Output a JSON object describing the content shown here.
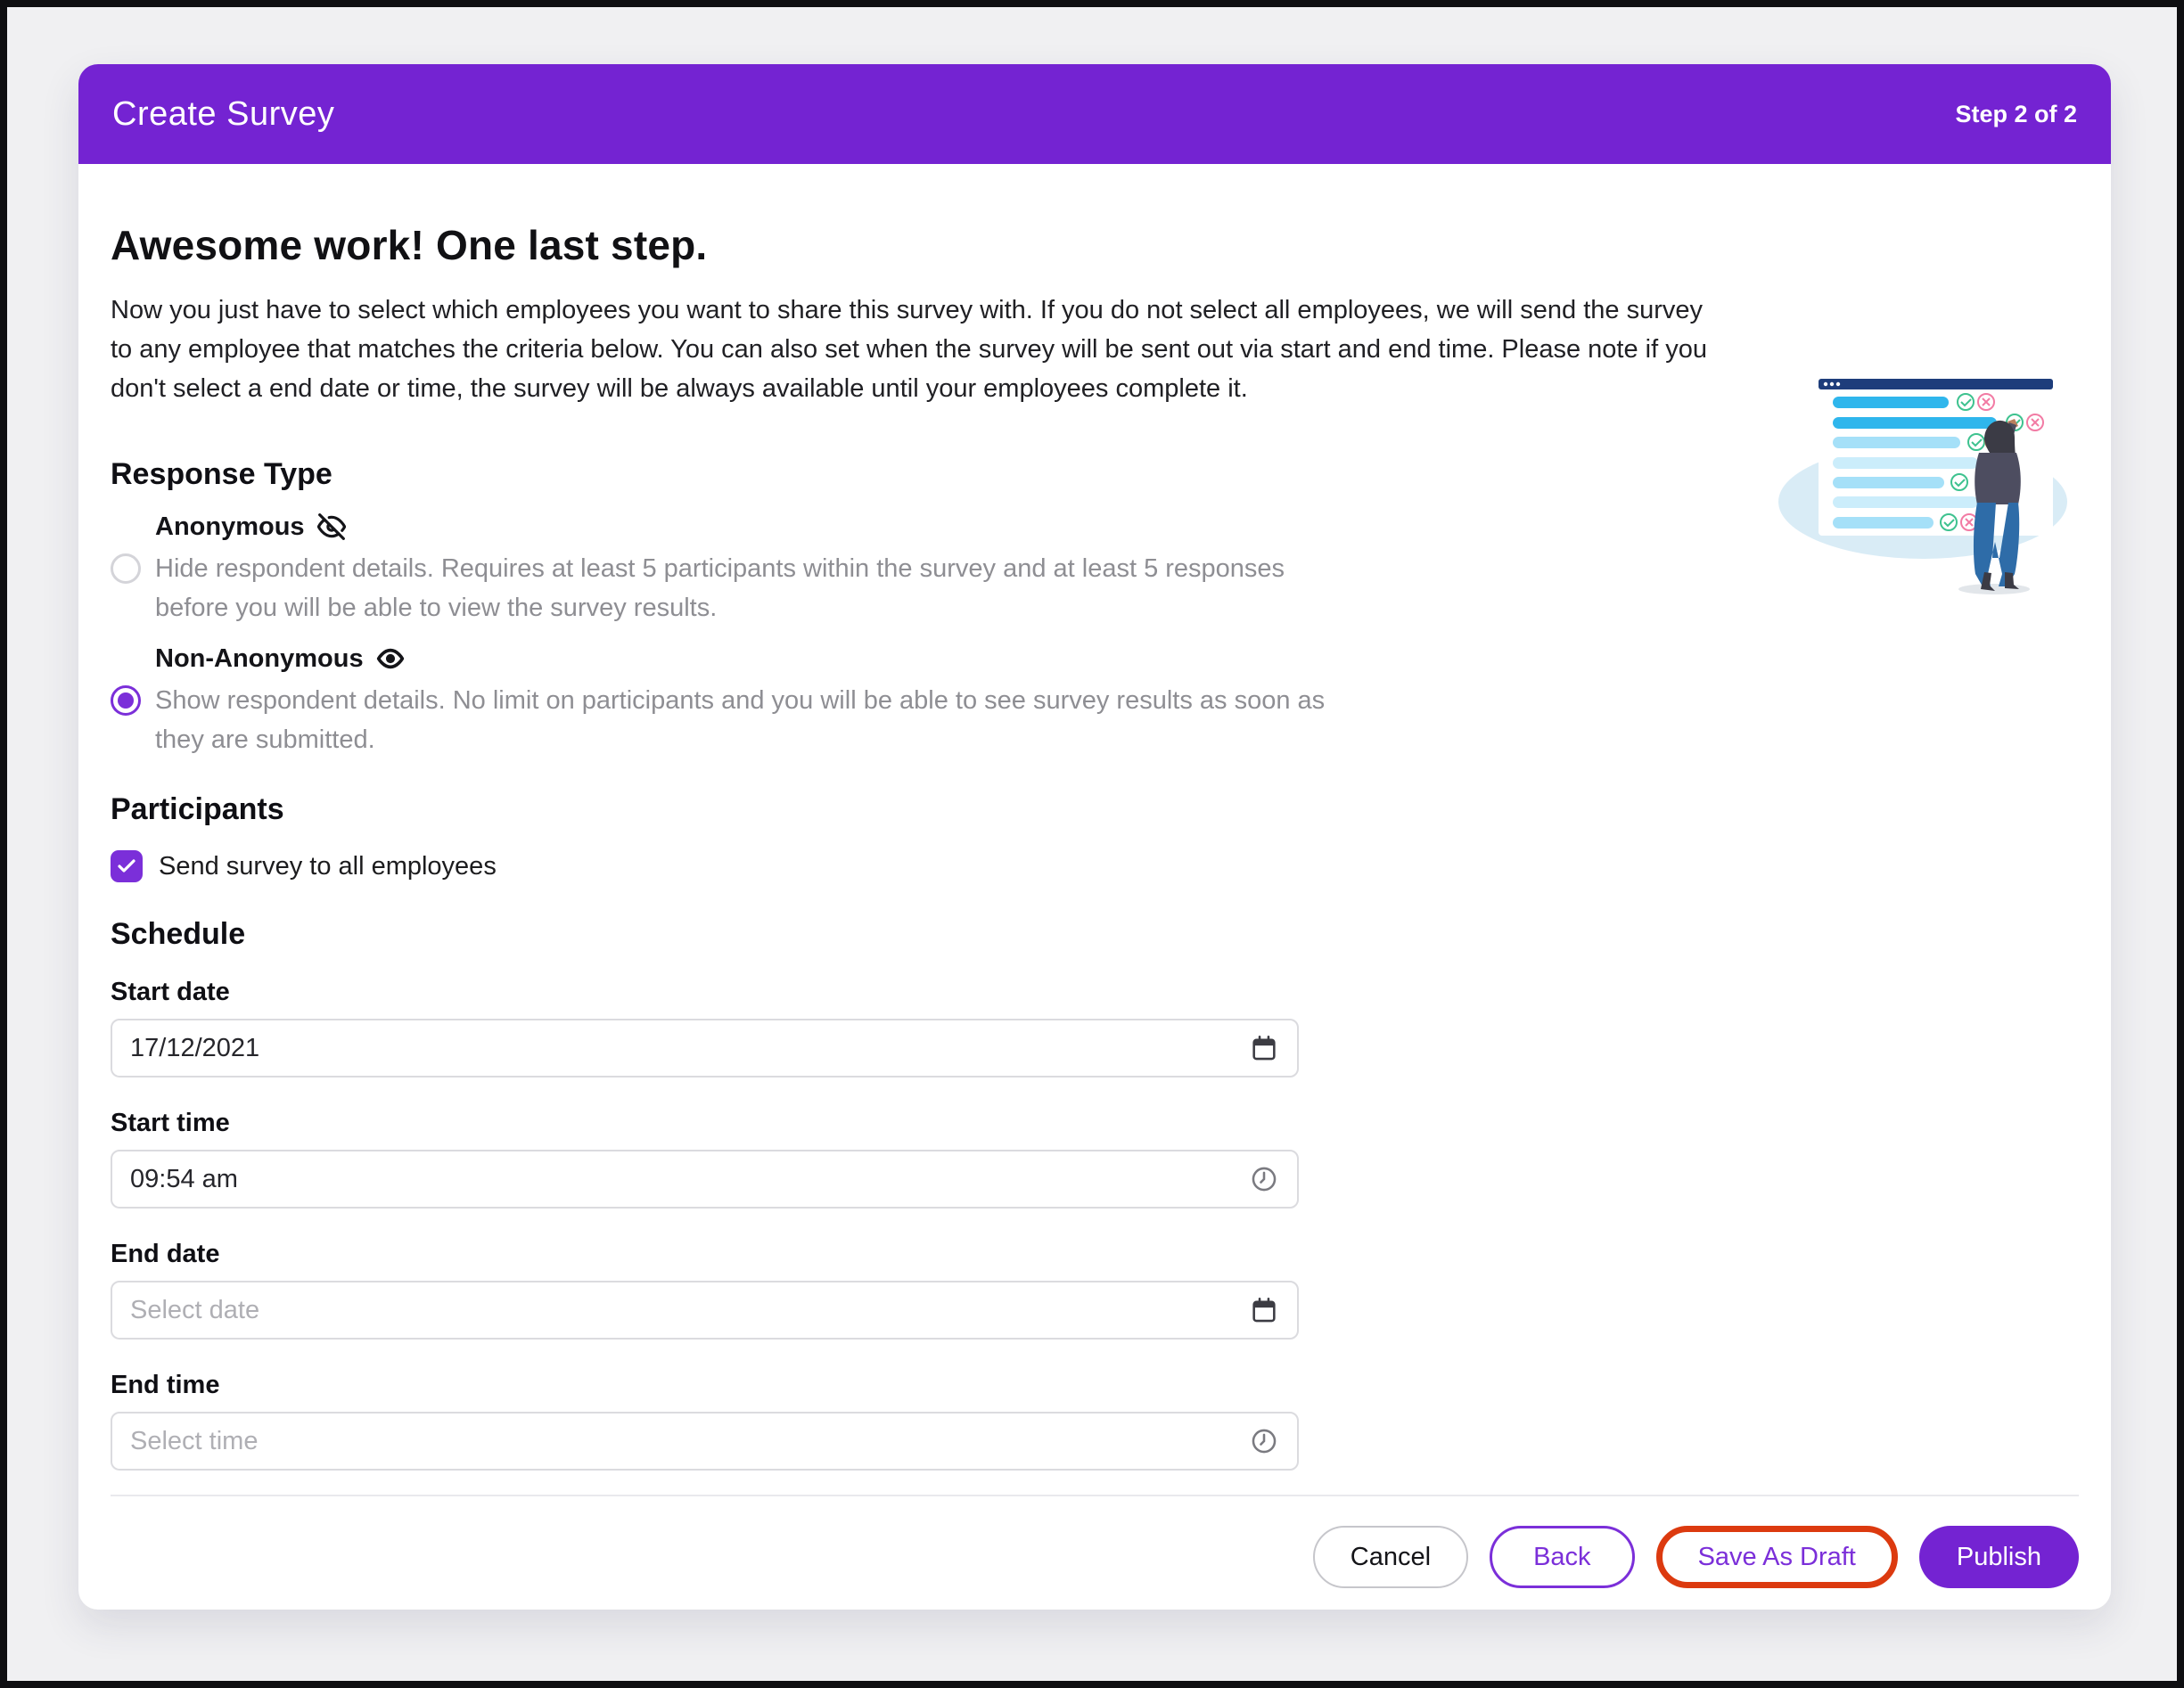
{
  "header": {
    "title": "Create Survey",
    "step": "Step 2 of 2"
  },
  "intro": {
    "title": "Awesome work! One last step.",
    "description": "Now you just have to select which employees you want to share this survey with. If you do not select all employees, we will send the survey to any employee that matches the criteria below. You can also set when the survey will be sent out via start and end time. Please note if you don't select a end date or time, the survey will be always available until your employees complete it."
  },
  "response_type": {
    "heading": "Response Type",
    "options": [
      {
        "label": "Anonymous",
        "icon": "eye-off-icon",
        "selected": false,
        "description": "Hide respondent details. Requires at least 5 participants within the survey and at least 5 responses before you will be able to view the survey results."
      },
      {
        "label": "Non-Anonymous",
        "icon": "eye-icon",
        "selected": true,
        "description": "Show respondent details. No limit on participants and you will be able to see survey results as soon as they are submitted."
      }
    ]
  },
  "participants": {
    "heading": "Participants",
    "checkbox_label": "Send survey to all employees",
    "checked": true
  },
  "schedule": {
    "heading": "Schedule",
    "fields": [
      {
        "label": "Start date",
        "value": "17/12/2021",
        "placeholder": "",
        "icon": "calendar-icon"
      },
      {
        "label": "Start time",
        "value": "09:54 am",
        "placeholder": "",
        "icon": "clock-icon"
      },
      {
        "label": "End date",
        "value": "",
        "placeholder": "Select date",
        "icon": "calendar-icon"
      },
      {
        "label": "End time",
        "value": "",
        "placeholder": "Select time",
        "icon": "clock-icon"
      }
    ]
  },
  "footer": {
    "buttons": [
      {
        "label": "Cancel"
      },
      {
        "label": "Back"
      },
      {
        "label": "Save As Draft",
        "highlighted": true
      },
      {
        "label": "Publish",
        "primary": true
      }
    ]
  },
  "colors": {
    "primary": "#7423D2",
    "control_purple": "#7B2FD9",
    "highlight_ring": "#DC3A0F",
    "muted_text": "#8E8E93",
    "page_bg": "#F0F0F2"
  }
}
